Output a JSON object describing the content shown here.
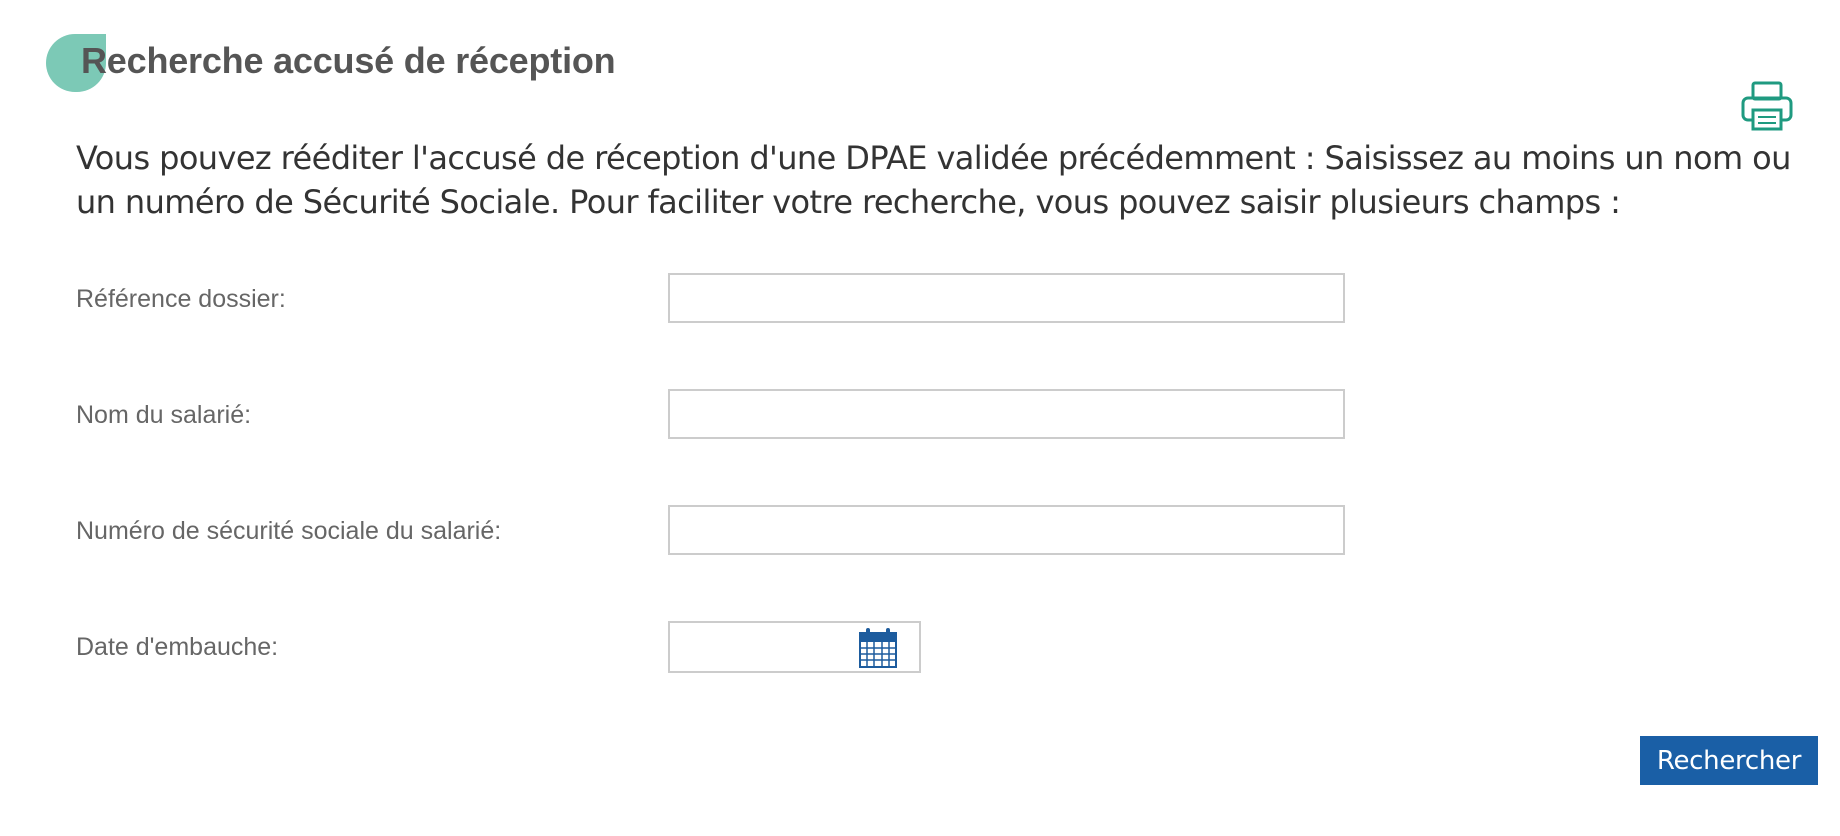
{
  "header": {
    "title": "Recherche accusé de réception"
  },
  "toolbar": {
    "print_icon": "printer-icon"
  },
  "intro": {
    "text": "Vous pouvez rééditer l'accusé de réception d'une DPAE validée précédemment : Saisissez au moins un nom ou un numéro de Sécurité Sociale. Pour faciliter votre recherche, vous pouvez saisir plusieurs champs :"
  },
  "form": {
    "reference": {
      "label": "Référence dossier:",
      "value": "",
      "placeholder": ""
    },
    "nom": {
      "label": "Nom du salarié:",
      "value": "",
      "placeholder": ""
    },
    "nss": {
      "label": "Numéro de sécurité sociale du salarié:",
      "value": "",
      "placeholder": ""
    },
    "date": {
      "label": "Date d'embauche:",
      "value": "",
      "placeholder": "",
      "icon": "calendar-icon"
    },
    "submit_label": "Rechercher"
  },
  "colors": {
    "accent": "#7cc9b6",
    "icon_green": "#1f9a80",
    "button_blue": "#1a5fa6",
    "calendar_blue": "#1d5c9e",
    "label_gray": "#666666",
    "title_gray": "#555555"
  }
}
